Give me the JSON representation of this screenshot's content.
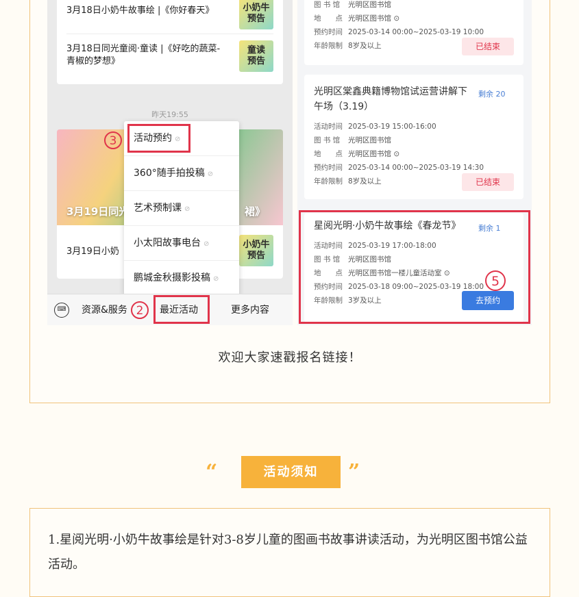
{
  "left_shot": {
    "msg1_text": "3月18日小奶牛故事绘 |《你好春天》",
    "msg1_thumb": "小奶牛\n预告",
    "msg2_text_line1": "3月18日同光童阅·童读 |《好吃的蔬菜-",
    "msg2_text_line2": "青椒的梦想》",
    "msg2_thumb": "童读\n预告",
    "time_tag": "昨天19:55",
    "banner_title": "3月19日同光",
    "banner_suffix": "裙》",
    "msg3_text": "3月19日小奶",
    "msg3_thumb": "小奶牛\n预告",
    "popup_items": [
      "活动预约",
      "360°随手拍投稿",
      "艺术预制课",
      "小太阳故事电台",
      "鹏城金秋摄影投稿"
    ],
    "bottom_bar": {
      "keyboard_icon": "keyboard-icon",
      "item1": "资源&服务",
      "item2": "最近活动",
      "item3": "更多内容"
    },
    "marker_2": "2",
    "marker_3": "3"
  },
  "right_shot": {
    "card0": {
      "row_library_key": "图 书 馆",
      "row_library_val": "光明区图书馆",
      "row_place_key": "地　　点",
      "row_place_val": "光明区图书馆",
      "row_book_key": "预约时间",
      "row_book_val": "2025-03-14 00:00~2025-03-19 10:00",
      "row_age_key": "年龄限制",
      "row_age_val": "8岁及以上",
      "status": "已结束"
    },
    "card1": {
      "title_line1": "光明区棠鑫典籍博物馆试运营讲解下",
      "title_line2": "午场（3.19）",
      "remain": "剩余 20",
      "row_time_key": "活动时间",
      "row_time_val": "2025-03-19 15:00-16:00",
      "row_library_key": "图 书 馆",
      "row_library_val": "光明区图书馆",
      "row_place_key": "地　　点",
      "row_place_val": "光明区图书馆",
      "row_book_key": "预约时间",
      "row_book_val": "2025-03-14 00:00~2025-03-19 14:30",
      "row_age_key": "年龄限制",
      "row_age_val": "8岁及以上",
      "status": "已结束"
    },
    "card2": {
      "title": "星阅光明·小奶牛故事绘《春龙节》",
      "remain": "剩余 1",
      "row_time_key": "活动时间",
      "row_time_val": "2025-03-19 17:00-18:00",
      "row_library_key": "图 书 馆",
      "row_library_val": "光明区图书馆",
      "row_place_key": "地　　点",
      "row_place_val": "光明区图书馆一楼儿童活动室",
      "row_book_key": "预约时间",
      "row_book_val": "2025-03-18 09:00~2025-03-19 18:00",
      "row_age_key": "年龄限制",
      "row_age_val": "3岁及以上",
      "button": "去预约"
    },
    "marker_5": "5"
  },
  "caption": "欢迎大家速戳报名链接！",
  "section_heading": "活动须知",
  "quote_open": "“",
  "quote_close": "”",
  "notice_text": "1.星阅光明·小奶牛故事绘是针对3-8岁儿童的图画书故事讲读活动，为光明区图书馆公益活动。",
  "colors": {
    "accent": "#f7b23b",
    "highlight_red": "#e0344a",
    "button_blue": "#3a7be0"
  }
}
